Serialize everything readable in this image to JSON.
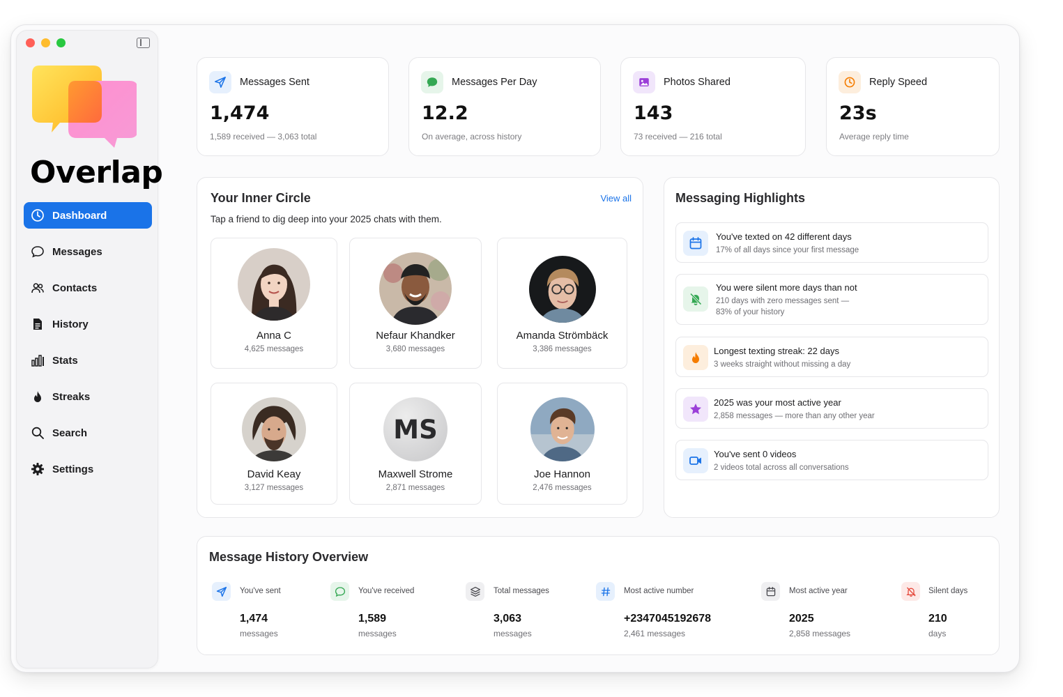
{
  "app": {
    "brand": "Overlap"
  },
  "sidebar": {
    "items": [
      {
        "label": "Dashboard",
        "icon": "gauge-icon",
        "active": true
      },
      {
        "label": "Messages",
        "icon": "chat-bubble-icon"
      },
      {
        "label": "Contacts",
        "icon": "people-icon"
      },
      {
        "label": "History",
        "icon": "document-icon"
      },
      {
        "label": "Stats",
        "icon": "bar-chart-icon"
      },
      {
        "label": "Streaks",
        "icon": "flame-icon"
      },
      {
        "label": "Search",
        "icon": "search-icon"
      },
      {
        "label": "Settings",
        "icon": "gear-icon"
      }
    ]
  },
  "stats": [
    {
      "title": "Messages Sent",
      "value": "1,474",
      "sub": "1,589 received — 3,063 total",
      "icon": "paper-plane-icon",
      "color": "#1a73e8"
    },
    {
      "title": "Messages Per Day",
      "value": "12.2",
      "sub": "On average, across history",
      "icon": "message-bubble-icon",
      "color": "#34a853"
    },
    {
      "title": "Photos Shared",
      "value": "143",
      "sub": "73 received — 216 total",
      "icon": "photo-icon",
      "color": "#9b3fd8"
    },
    {
      "title": "Reply Speed",
      "value": "23s",
      "sub": "Average reply time",
      "icon": "clock-icon",
      "color": "#f57c00"
    }
  ],
  "inner_circle": {
    "title": "Your Inner Circle",
    "view_all": "View all",
    "subtitle": "Tap a friend to dig deep into your 2025 chats with them.",
    "friends": [
      {
        "name": "Anna C",
        "count": "4,625 messages"
      },
      {
        "name": "Nefaur Khandker",
        "count": "3,680 messages"
      },
      {
        "name": "Amanda Strömbäck",
        "count": "3,386 messages"
      },
      {
        "name": "David Keay",
        "count": "3,127 messages"
      },
      {
        "name": "Maxwell Strome",
        "count": "2,871 messages",
        "initials": "MS"
      },
      {
        "name": "Joe Hannon",
        "count": "2,476 messages"
      }
    ]
  },
  "highlights": {
    "title": "Messaging Highlights",
    "items": [
      {
        "title": "You've texted on 42 different days",
        "sub": "17% of all days since your first message",
        "icon": "calendar-icon",
        "color": "#1a73e8"
      },
      {
        "title": "You were silent more days than not",
        "sub": "210 days with zero messages sent —",
        "sub2": "83% of your history",
        "icon": "bell-off-icon",
        "color": "#34a853"
      },
      {
        "title": "Longest texting streak: 22 days",
        "sub": "3 weeks straight without missing a day",
        "icon": "flame-icon",
        "color": "#f57c00"
      },
      {
        "title": "2025 was your most active year",
        "sub": "2,858 messages — more than any other year",
        "icon": "star-icon",
        "color": "#9b3fd8"
      },
      {
        "title": "You've sent 0 videos",
        "sub": "2 videos total across all conversations",
        "icon": "video-icon",
        "color": "#1a73e8"
      }
    ]
  },
  "overview": {
    "title": "Message History Overview",
    "items": [
      {
        "label": "You've sent",
        "value": "1,474",
        "sub": "messages",
        "icon": "paper-plane-icon",
        "color": "#1a73e8"
      },
      {
        "label": "You've received",
        "value": "1,589",
        "sub": "messages",
        "icon": "message-bubble-icon",
        "color": "#34a853"
      },
      {
        "label": "Total messages",
        "value": "3,063",
        "sub": "messages",
        "icon": "layers-icon",
        "color": "#48484d"
      },
      {
        "label": "Most active number",
        "value": "+2347045192678",
        "sub": "2,461 messages",
        "icon": "hash-icon",
        "color": "#1a73e8"
      },
      {
        "label": "Most active year",
        "value": "2025",
        "sub": "2,858 messages",
        "icon": "calendar-icon",
        "color": "#48484d"
      },
      {
        "label": "Silent days",
        "value": "210",
        "sub": "days",
        "icon": "bell-off-icon",
        "color": "#e5483b"
      }
    ]
  }
}
